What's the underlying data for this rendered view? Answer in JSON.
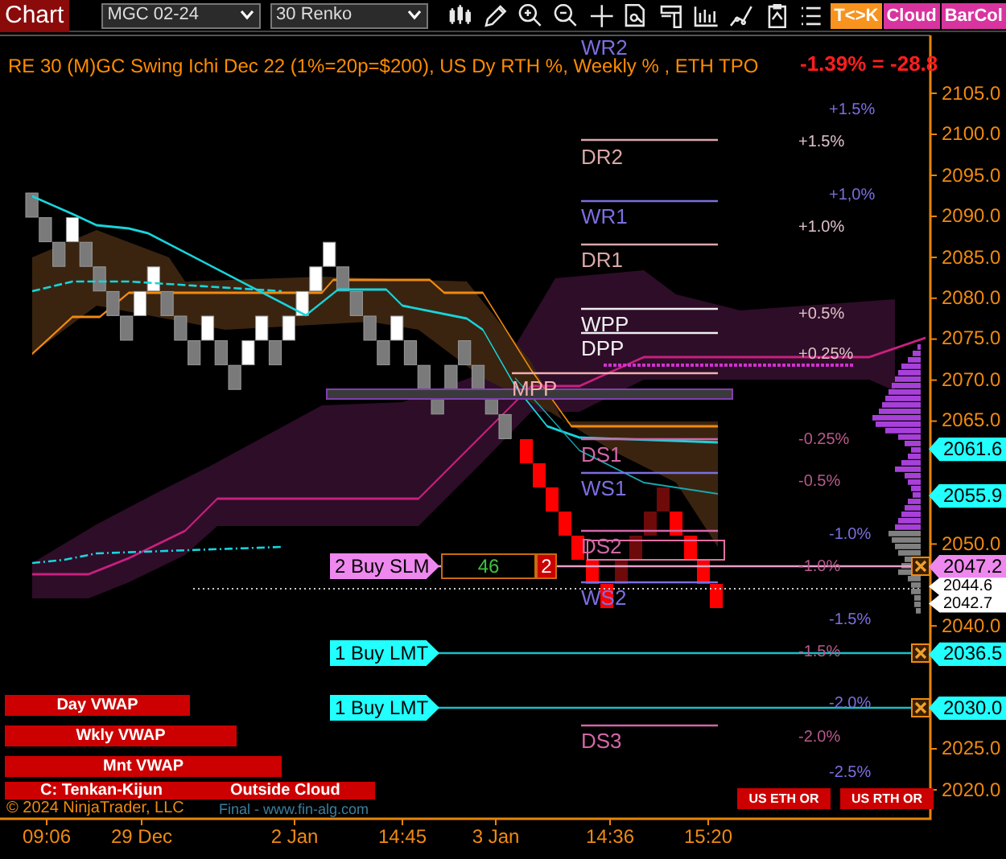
{
  "toolbar": {
    "title": "Chart",
    "instrument": "MGC 02-24",
    "bar_type": "30 Renko",
    "toggles": [
      {
        "label": "T<>K",
        "color": "#f7931e"
      },
      {
        "label": "Cloud",
        "color": "#d8349f"
      },
      {
        "label": "BarCol",
        "color": "#d8349f"
      }
    ]
  },
  "chart": {
    "title": "RE 30 (M)GC Swing Ichi Dec 22 (1%=20p=$200), US Dy RTH %, Weekly % , ETH TPO",
    "pnl": "-1.39% = -28.8",
    "pivots": [
      {
        "label": "WR2",
        "kind": "weekly"
      },
      {
        "label": "DR2",
        "kind": "daily_resistance"
      },
      {
        "label": "WR1",
        "kind": "weekly"
      },
      {
        "label": "DR1",
        "kind": "daily_resistance"
      },
      {
        "label": "WPP",
        "kind": "pivot"
      },
      {
        "label": "DPP",
        "kind": "pivot"
      },
      {
        "label": "MPP",
        "kind": "monthly"
      },
      {
        "label": "DS1",
        "kind": "daily_support"
      },
      {
        "label": "WS1",
        "kind": "weekly"
      },
      {
        "label": "DS2",
        "kind": "daily_support"
      },
      {
        "label": "WS2",
        "kind": "weekly"
      },
      {
        "label": "DS3",
        "kind": "daily_support"
      }
    ],
    "percent_labels": [
      {
        "text": "+1.5%",
        "kind": "weekly"
      },
      {
        "text": "+1.5%",
        "kind": "daily_up"
      },
      {
        "text": "+1,0%",
        "kind": "weekly"
      },
      {
        "text": "+1.0%",
        "kind": "daily_up"
      },
      {
        "text": "+0.5%",
        "kind": "daily_up"
      },
      {
        "text": "+0.25%",
        "kind": "daily_up"
      },
      {
        "text": "-0.25%",
        "kind": "daily_down"
      },
      {
        "text": "-0.5%",
        "kind": "daily_down"
      },
      {
        "text": "-1.0%",
        "kind": "weekly"
      },
      {
        "text": "-1.0%",
        "kind": "daily_down"
      },
      {
        "text": "-1.5%",
        "kind": "weekly"
      },
      {
        "text": "-1.5%",
        "kind": "daily_down"
      },
      {
        "text": "-2.0%",
        "kind": "weekly"
      },
      {
        "text": "-2.0%",
        "kind": "daily_down"
      },
      {
        "text": "-2.5%",
        "kind": "weekly"
      }
    ],
    "orders": [
      {
        "label": "2 Buy SLM",
        "kind": "stop",
        "quantity": "46",
        "filled": "2"
      },
      {
        "label": "1 Buy LMT",
        "kind": "limit"
      },
      {
        "label": "1 Buy LMT",
        "kind": "limit"
      }
    ],
    "price_axis": [
      "2105.0",
      "2100.0",
      "2095.0",
      "2090.0",
      "2085.0",
      "2080.0",
      "2075.0",
      "2070.0",
      "2065.0",
      "2050.0",
      "2040.0",
      "2025.0",
      "2020.0"
    ],
    "price_markers": [
      {
        "text": "2061.6",
        "kind": "line"
      },
      {
        "text": "2055.9",
        "kind": "line"
      },
      {
        "text": "2047.2",
        "kind": "order"
      },
      {
        "text": "2044.6",
        "kind": "last"
      },
      {
        "text": "2042.7",
        "kind": "last"
      },
      {
        "text": "2036.5",
        "kind": "order_limit"
      },
      {
        "text": "2030.0",
        "kind": "order_limit"
      }
    ],
    "time_axis": [
      "09:06",
      "29 Dec",
      "2 Jan",
      "14:45",
      "3 Jan",
      "14:36",
      "15:20"
    ],
    "legend": [
      "Day VWAP",
      "Wkly VWAP",
      "Mnt VWAP"
    ],
    "cloud_status": {
      "name": "C: Tenkan-Kijun",
      "value": "Outside Cloud"
    },
    "or_labels": [
      "US ETH OR",
      "US RTH OR"
    ],
    "copyright": "© 2024 NinjaTrader, LLC",
    "watermark_link": "Final - www.fin-alg.com"
  }
}
